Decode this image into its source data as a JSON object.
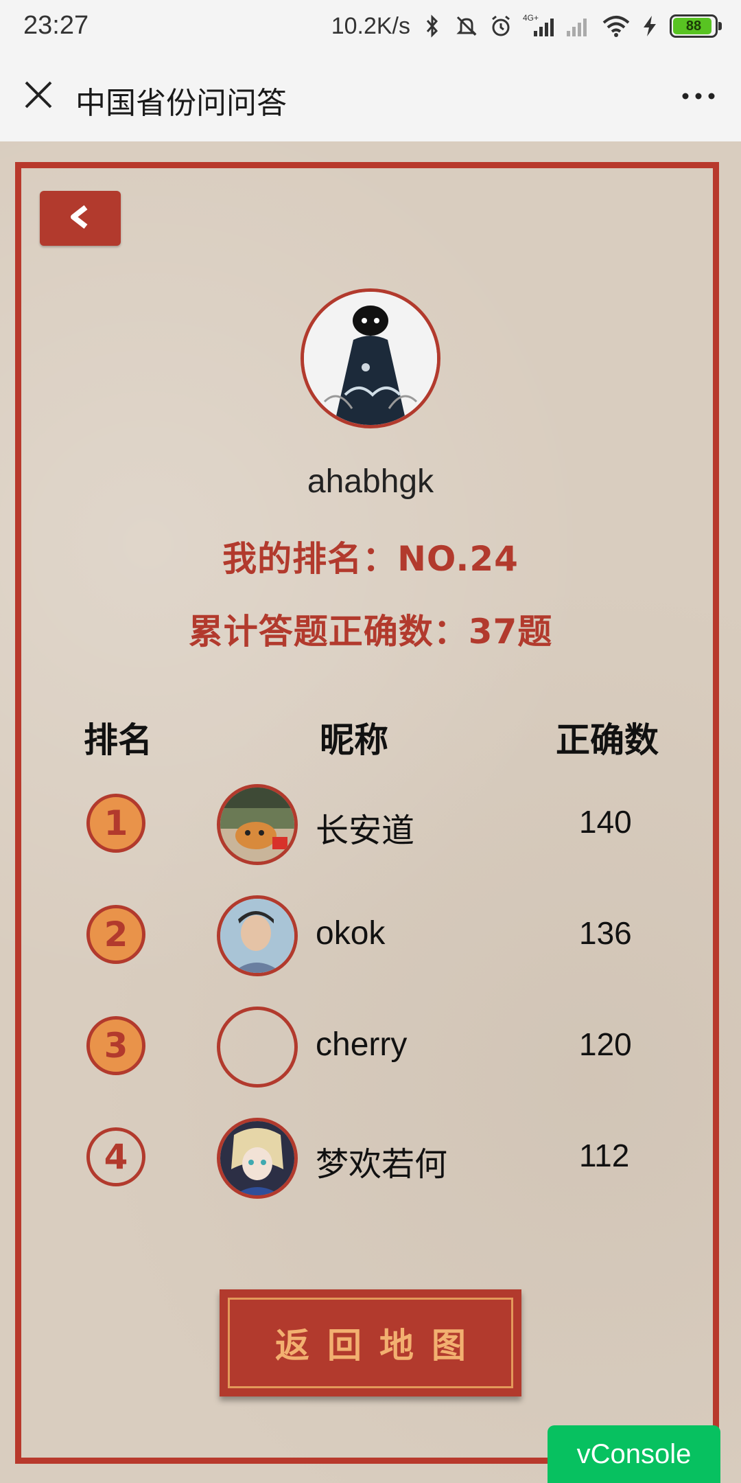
{
  "status_bar": {
    "time": "23:27",
    "net_speed": "10.2K/s",
    "network_label": "4G+",
    "battery": "88",
    "icons": [
      "bluetooth-icon",
      "mute-icon",
      "alarm-icon",
      "signal-icon",
      "signal-empty-icon",
      "wifi-icon",
      "charging-icon",
      "battery-icon"
    ]
  },
  "title_bar": {
    "title": "中国省份问问答",
    "close_icon": "close-icon",
    "more_icon": "more-icon"
  },
  "profile": {
    "name": "ahabhgk",
    "rank_line": "我的排名：NO.24",
    "total_line": "累计答题正确数：37题"
  },
  "table": {
    "headers": {
      "rank": "排名",
      "name": "昵称",
      "score": "正确数"
    },
    "rows": [
      {
        "rank": "1",
        "name": "长安道",
        "score": "140"
      },
      {
        "rank": "2",
        "name": "okok",
        "score": "136"
      },
      {
        "rank": "3",
        "name": "cherry",
        "score": "120"
      },
      {
        "rank": "4",
        "name": "梦欢若何",
        "score": "112"
      }
    ]
  },
  "buttons": {
    "return_map": "返回地图",
    "vconsole": "vConsole"
  },
  "colors": {
    "accent": "#b23a2d",
    "badge_fill": "#e9934a",
    "button_text": "#f2b070",
    "paper": "#d9cdbf",
    "vconsole": "#07c160"
  }
}
